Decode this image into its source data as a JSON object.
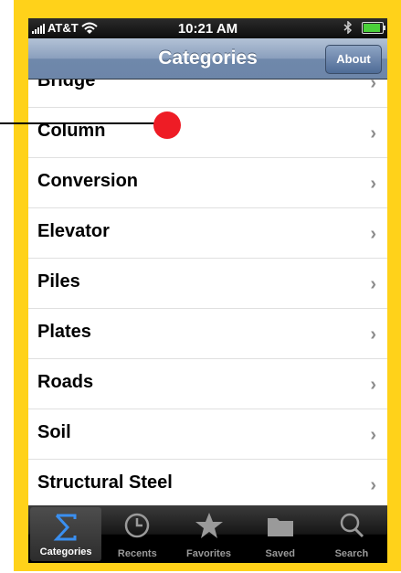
{
  "status_bar": {
    "carrier": "AT&T",
    "time": "10:21 AM"
  },
  "nav": {
    "title": "Categories",
    "about_label": "About"
  },
  "categories": [
    {
      "label": "Bridge"
    },
    {
      "label": "Column"
    },
    {
      "label": "Conversion"
    },
    {
      "label": "Elevator"
    },
    {
      "label": "Piles"
    },
    {
      "label": "Plates"
    },
    {
      "label": "Roads"
    },
    {
      "label": "Soil"
    },
    {
      "label": "Structural Steel"
    }
  ],
  "tabs": [
    {
      "label": "Categories",
      "icon": "sigma-icon",
      "selected": true
    },
    {
      "label": "Recents",
      "icon": "clock-icon",
      "selected": false
    },
    {
      "label": "Favorites",
      "icon": "star-icon",
      "selected": false
    },
    {
      "label": "Saved",
      "icon": "folder-icon",
      "selected": false
    },
    {
      "label": "Search",
      "icon": "magnifier-icon",
      "selected": false
    }
  ],
  "colors": {
    "frame": "#ffd21a",
    "nav_bar": "#7d94b5",
    "callout_dot": "#ee1c25",
    "chevron": "#8c8c8c"
  }
}
